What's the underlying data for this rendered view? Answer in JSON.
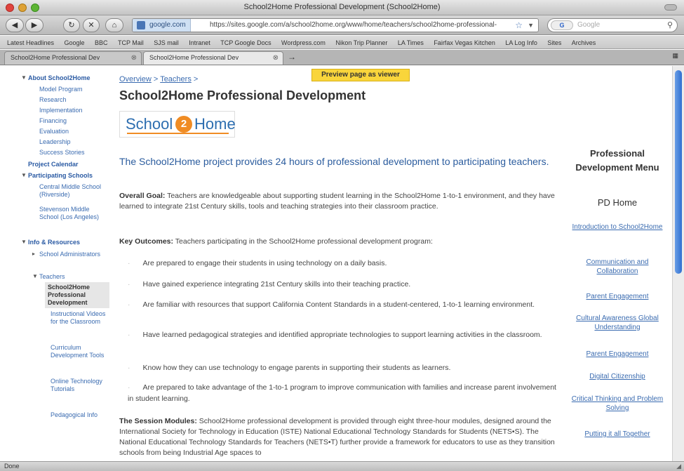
{
  "window": {
    "title": "School2Home Professional Development (School2Home)"
  },
  "navbar": {
    "site_identity": "google.com",
    "url": "https://sites.google.com/a/school2home.org/www/home/teachers/school2home-professional-",
    "search_engine": "G",
    "search_placeholder": "Google"
  },
  "bookmarks": [
    "Latest Headlines",
    "Google",
    "BBC",
    "TCP Mail",
    "SJS mail",
    "Intranet",
    "TCP Google Docs",
    "Wordpress.com",
    "Nikon Trip Planner",
    "LA Times",
    "Fairfax Vegas Kitchen",
    "LA Log Info",
    "Sites",
    "Archives"
  ],
  "tabs": [
    {
      "label": "School2Home Professional Dev"
    },
    {
      "label": "School2Home Professional Dev"
    }
  ],
  "left_nav": {
    "about_header": "About School2Home",
    "about_items": [
      "Model Program",
      "Research",
      "Implementation",
      "Financing",
      "Evaluation",
      "Leadership",
      "Success Stories"
    ],
    "project_calendar": "Project Calendar",
    "participating_header": "Participating Schools",
    "participating_items": [
      "Central Middle School (Riverside)",
      "Stevenson Middle School (Los Angeles)"
    ],
    "info_header": "Info & Resources",
    "school_admin": "School Administrators",
    "teachers": "Teachers",
    "selected": "School2Home Professional Development",
    "teacher_items": [
      "Instructional Videos for the Classroom",
      "Curriculum Development Tools",
      "Online Technology Tutorials",
      "Pedagogical Info"
    ]
  },
  "main": {
    "breadcrumb": [
      "Overview",
      "Teachers"
    ],
    "preview_label": "Preview page as viewer",
    "title": "School2Home Professional Development",
    "logo_left": "School",
    "logo_mid": "2",
    "logo_right": "Home",
    "lead": "The School2Home project provides 24 hours of professional development to participating teachers.",
    "goal_label": "Overall Goal:",
    "goal_text": "Teachers are knowledgeable about supporting student learning in the School2Home 1-to-1 environment, and they have learned to integrate 21st Century skills, tools and teaching strategies into their classroom practice.",
    "outcomes_label": "Key Outcomes:",
    "outcomes_text": "Teachers participating in the School2Home professional development program:",
    "outcomes": [
      "Are prepared to engage their students in using technology on a daily basis.",
      "Have gained experience integrating 21st Century skills into their teaching practice.",
      "Are familiar with resources that support California Content Standards in a student-centered, 1-to-1 learning environment.",
      "Have learned pedagogical strategies and identified appropriate technologies to support learning activities in the classroom.",
      "Know how they can use technology to engage parents in supporting their students as learners.",
      "Are prepared to take advantage of the 1-to-1 program to improve communication with families and increase parent involvement in student learning."
    ],
    "modules_label": "The Session Modules:",
    "modules_text": "School2Home professional development is provided through eight three-hour modules, designed around the International Society for Technology in Education (ISTE) National Educational Technology Standards for Students (NETS•S). The National Educational Technology Standards for Teachers (NETS•T) further provide a framework for educators to use as they transition schools from being Industrial Age spaces to"
  },
  "right_menu": {
    "title": "Professional Development Menu",
    "home": "PD Home",
    "links": [
      "Introduction to School2Home",
      "Communication and Collaboration",
      "Parent Engagement",
      "Cultural Awareness Global Understanding",
      "Parent Engagement",
      "Digital Citizenship",
      "Critical Thinking and Problem Solving",
      "Putting it all Together"
    ]
  },
  "status": {
    "text": "Done"
  }
}
